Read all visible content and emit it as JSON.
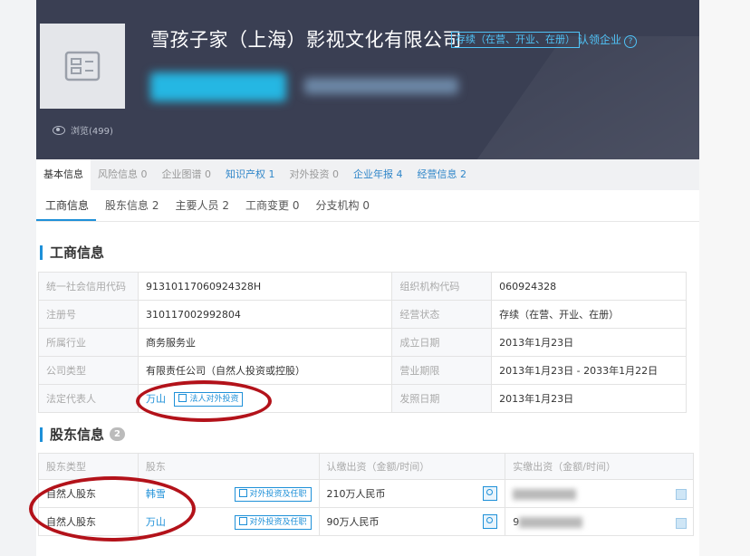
{
  "company": {
    "name": "雪孩子家（上海）影视文化有限公司",
    "status_tag": "存续（在营、开业、在册）",
    "claim": "认领企业",
    "views": "浏览(499)"
  },
  "tabs": [
    {
      "label": "基本信息",
      "count": ""
    },
    {
      "label": "风险信息",
      "count": "0"
    },
    {
      "label": "企业图谱",
      "count": "0"
    },
    {
      "label": "知识产权",
      "count": "1"
    },
    {
      "label": "对外投资",
      "count": "0"
    },
    {
      "label": "企业年报",
      "count": "4"
    },
    {
      "label": "经营信息",
      "count": "2"
    }
  ],
  "subtabs": [
    {
      "label": "工商信息",
      "count": ""
    },
    {
      "label": "股东信息",
      "count": "2"
    },
    {
      "label": "主要人员",
      "count": "2"
    },
    {
      "label": "工商变更",
      "count": "0"
    },
    {
      "label": "分支机构",
      "count": "0"
    }
  ],
  "biz_section": {
    "title": "工商信息",
    "rows": [
      {
        "l1": "统一社会信用代码",
        "v1": "91310117060924328H",
        "l2": "组织机构代码",
        "v2": "060924328"
      },
      {
        "l1": "注册号",
        "v1": "310117002992804",
        "l2": "经营状态",
        "v2": "存续（在营、开业、在册）"
      },
      {
        "l1": "所属行业",
        "v1": "商务服务业",
        "l2": "成立日期",
        "v2": "2013年1月23日"
      },
      {
        "l1": "公司类型",
        "v1": "有限责任公司（自然人投资或控股）",
        "l2": "营业期限",
        "v2": "2013年1月23日 - 2033年1月22日"
      },
      {
        "l1": "法定代表人",
        "v1": "万山",
        "l2": "发照日期",
        "v2": "2013年1月23日"
      }
    ],
    "legal_btn": "法人对外投资"
  },
  "holder_section": {
    "title": "股东信息",
    "count": "2",
    "headers": [
      "股东类型",
      "股东",
      "认缴出资（金额/时间）",
      "实缴出资（金额/时间）"
    ],
    "rows": [
      {
        "type": "自然人股东",
        "name": "韩雪",
        "btn": "对外投资及任职",
        "subscribed": "210万人民币",
        "paid": ""
      },
      {
        "type": "自然人股东",
        "name": "万山",
        "btn": "对外投资及任职",
        "subscribed": "90万人民币",
        "paid": "9"
      }
    ]
  }
}
